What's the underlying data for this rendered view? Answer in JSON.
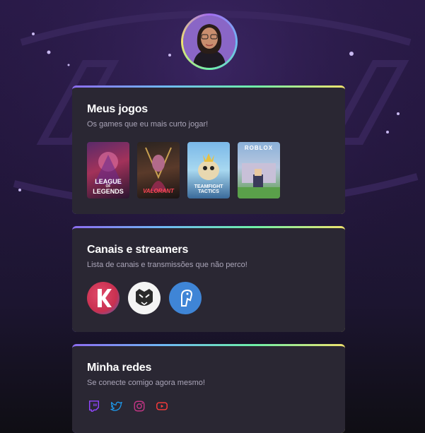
{
  "colors": {
    "card_bg": "#2a2733",
    "accent_gradient": [
      "#8c6cf0",
      "#6fb8f5",
      "#6ef0a8",
      "#f0e36e"
    ],
    "twitch": "#9146ff",
    "twitter": "#1d9bf0",
    "instagram": "#c13584",
    "youtube": "#ff3b3b"
  },
  "profile": {
    "avatar": "profile-photo"
  },
  "games_section": {
    "title": "Meus jogos",
    "subtitle": "Os games que eu mais curto jogar!",
    "games": [
      {
        "name": "League of Legends",
        "caption_1": "LEAGUE",
        "caption_2": "OF",
        "caption_3": "LEGENDS"
      },
      {
        "name": "Valorant",
        "caption_1": "VALORANT"
      },
      {
        "name": "Teamfight Tactics",
        "caption_1": "TEAMFIGHT",
        "caption_2": "TACTICS"
      },
      {
        "name": "Roblox",
        "caption_1": "ROBLOX"
      }
    ]
  },
  "channels_section": {
    "title": "Canais e streamers",
    "subtitle": "Lista de canais e transmissões que não perco!",
    "channels": [
      {
        "icon": "k-logo-icon"
      },
      {
        "icon": "tiger-logo-icon"
      },
      {
        "icon": "bird-logo-icon"
      }
    ]
  },
  "social_section": {
    "title": "Minha redes",
    "subtitle": "Se conecte comigo agora mesmo!",
    "links": [
      {
        "icon": "twitch-icon"
      },
      {
        "icon": "twitter-icon"
      },
      {
        "icon": "instagram-icon"
      },
      {
        "icon": "youtube-icon"
      }
    ]
  }
}
